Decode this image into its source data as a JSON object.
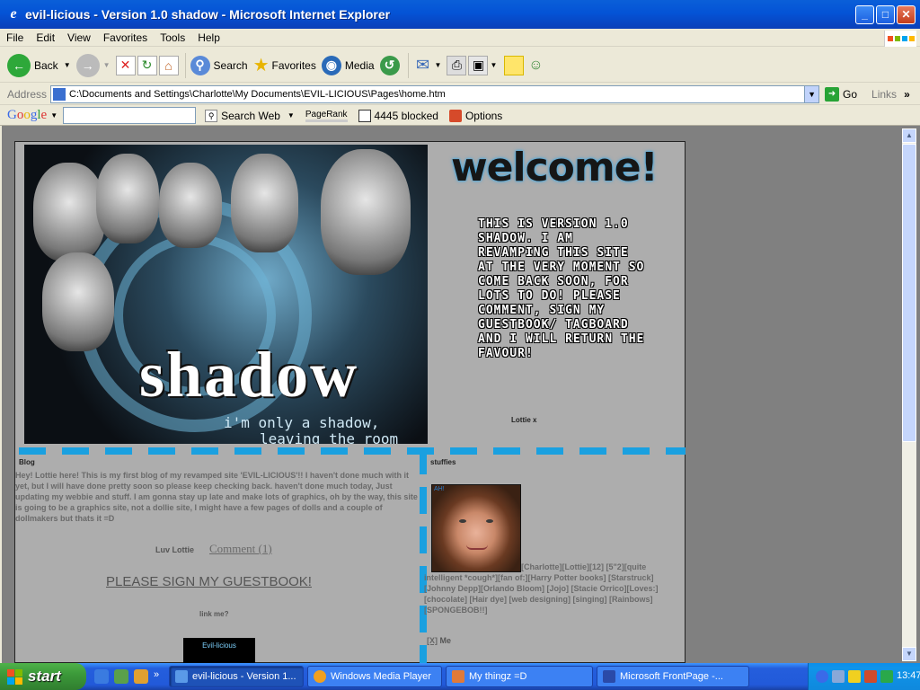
{
  "window": {
    "title": "evil-licious - Version 1.0 shadow - Microsoft Internet Explorer"
  },
  "menu": [
    "File",
    "Edit",
    "View",
    "Favorites",
    "Tools",
    "Help"
  ],
  "toolbar": {
    "back": "Back",
    "search": "Search",
    "favorites": "Favorites",
    "media": "Media"
  },
  "address": {
    "label": "Address",
    "value": "C:\\Documents and Settings\\Charlotte\\My Documents\\EVIL-LICIOUS\\Pages\\home.htm",
    "go": "Go",
    "links": "Links"
  },
  "google": {
    "logo": "Google",
    "search_web": "Search Web",
    "pagerank": "PageRank",
    "blocked": "4445 blocked",
    "options": "Options"
  },
  "page": {
    "banner_word": "shadow",
    "banner_tag1": "i'm only a shadow,",
    "banner_tag2": "leaving the room",
    "welcome": "welcome!",
    "intro": "THIS IS VERSION 1.0 SHADOW. I AM REVAMPING THIS SITE AT THE VERY MOMENT SO COME BACK SOON, FOR LOTS TO DO! PLEASE COMMENT, SIGN MY GUESTBOOK/ TAGBOARD AND I WILL RETURN THE FAVOUR!",
    "lottie_x": "Lottie x",
    "blog_label": "Blog",
    "stuffies_label": "stuffies",
    "blog_text": "Hey! Lottie here! This is my first blog of my revamped site 'EVIL-LICIOUS'!! I haven't done much with it yet, but I will have done pretty soon so please keep checking back. haven't done much today, Just updating my webbie and stuff. I am gonna stay up late and make lots of graphics, oh by the way, this site is going to be a graphics site, not a dollie site, I might have a few pages of dolls and a couple of dollmakers but thats it =D",
    "signoff": "Luv Lottie",
    "comment": "Comment (1)",
    "guestbook": "PLEASE SIGN MY GUESTBOOK!",
    "link_me": "link me?",
    "evil_button": "Evil-licious",
    "photo_tag": "AH!",
    "bio": "[Charlotte][Lottie][12] [5\"2][quite intelligent *cough*][fan of:][Harry Potter books] [Starstruck] [Johnny Depp][Orlando Bloom] [Jojo] [Stacie Orrico][Loves:] [chocolate] [Hair dye] [web designing] [singing] [Rainbows] [SPONGEBOB!!]",
    "me_link": "[X]",
    "me_text": "Me"
  },
  "taskbar": {
    "start": "start",
    "tasks": [
      "evil-licious - Version 1...",
      "Windows Media Player",
      "My thingz =D",
      "Microsoft FrontPage -..."
    ],
    "clock": "13:47"
  }
}
